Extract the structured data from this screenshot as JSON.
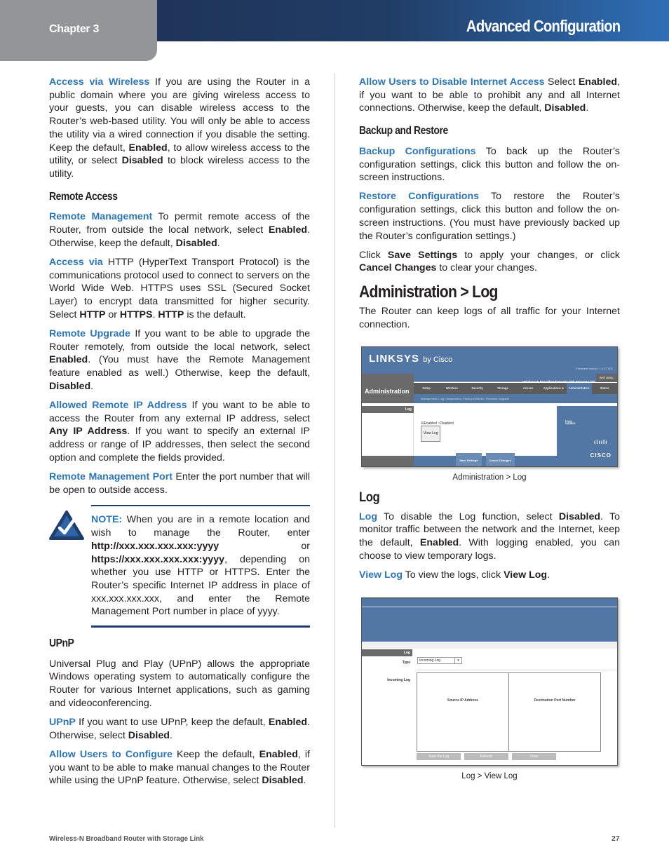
{
  "header": {
    "chapter": "Chapter 3",
    "title": "Advanced Configuration"
  },
  "left": {
    "access_wireless": {
      "term": "Access via Wireless",
      "t1": "  If you are using the Router in a public domain where you are giving wireless access to your guests, you can disable wireless access to the Router’s web-based utility. You will only be able to access the utility via a wired connection if you disable the setting. Keep the default, ",
      "b1": "Enabled",
      "t2": ", to allow wireless access to the utility, or select ",
      "b2": "Disabled",
      "t3": " to block wireless access to the utility."
    },
    "remote_access_heading": "Remote Access",
    "remote_mgmt": {
      "term": "Remote Management",
      "t1": "  To permit remote access of the Router, from outside the local network, select ",
      "b1": "Enabled",
      "t2": ". Otherwise, keep the default, ",
      "b2": "Disabled",
      "t3": "."
    },
    "access_via": {
      "term": "Access via",
      "t1": "  HTTP (HyperText Transport Protocol) is the communications protocol used to connect to servers on the World Wide Web. HTTPS uses SSL (Secured Socket Layer) to encrypt data transmitted for higher security. Select ",
      "b1": "HTTP",
      "t2": " or ",
      "b2": "HTTPS",
      "t3": ". ",
      "b3": "HTTP",
      "t4": " is the default."
    },
    "remote_upgrade": {
      "term": "Remote Upgrade",
      "t1": "  If you want to be able to upgrade the Router remotely, from outside the local network, select ",
      "b1": "Enabled",
      "t2": ". (You must have the Remote Management feature enabled as well.) Otherwise, keep the default, ",
      "b2": "Disabled",
      "t3": "."
    },
    "allowed_ip": {
      "term": "Allowed Remote IP Address",
      "t1": "  If you want to be able to access the Router from any external IP address, select ",
      "b1": "Any IP Address",
      "t2": ". If you want to specify an external IP address or range of IP addresses, then select the second option and complete the fields provided."
    },
    "remote_port": {
      "term": "Remote Management Port",
      "t1": "  Enter the port number that will be open to outside access."
    },
    "note": {
      "label": "NOTE:",
      "t1": " When you are in a remote location and wish to manage the Router, enter ",
      "b1": "http://xxx.xxx.xxx.xxx:yyyy",
      "t2": " or ",
      "b2": "https://xxx.xxx.xxx.xxx:yyyy",
      "t3": ", depending on whether you use HTTP or HTTPS. Enter the Router’s specific Internet IP address in place of xxx.xxx.xxx.xxx, and enter the Remote Management Port number in place of yyyy."
    },
    "upnp_heading": "UPnP",
    "upnp_intro": "Universal Plug and Play (UPnP) allows the appropriate Windows operating system to automatically configure the Router for various Internet applications, such as gaming and videoconferencing.",
    "upnp": {
      "term": "UPnP",
      "t1": "  If you want to use UPnP, keep the default, ",
      "b1": "Enabled",
      "t2": ". Otherwise, select ",
      "b2": "Disabled",
      "t3": "."
    },
    "allow_users": {
      "term": "Allow Users to Configure",
      "t1": "  Keep the default, ",
      "b1": "Enabled",
      "t2": ", if you want to be able to make manual changes to the Router while using the UPnP feature. Otherwise, select ",
      "b2": "Disabled",
      "t3": "."
    }
  },
  "right": {
    "allow_disable": {
      "term": "Allow Users to Disable Internet Access",
      "t1": "  Select ",
      "b1": "Enabled",
      "t2": ", if you want to be able to prohibit any and all Internet connections. Otherwise, keep the default, ",
      "b2": "Disabled",
      "t3": "."
    },
    "backup_heading": "Backup and Restore",
    "backup": {
      "term": "Backup Configurations",
      "t1": " To back up the Router’s configuration settings, click this button and follow the on-screen instructions."
    },
    "restore": {
      "term": "Restore Configurations",
      "t1": " To restore the Router’s configuration settings, click this button and follow the on-screen instructions. (You must have previously backed up the Router’s configuration settings.)"
    },
    "click": {
      "t1": "Click ",
      "b1": "Save Settings",
      "t2": " to apply your changes, or click ",
      "b2": "Cancel Changes",
      "t3": " to clear your changes."
    },
    "section_heading": "Administration > Log",
    "section_intro": "The Router can keep logs of all traffic for your Internet connection.",
    "fig1": {
      "logo": "LINKSYS",
      "logo_suffix": "by Cisco",
      "firmware": "Firmware Version: 1.0.07 B01",
      "product": "Wireless-N Broadband Router with Storage Link",
      "model": "WRT160NL",
      "section": "Administration",
      "tabs": [
        "Setup",
        "Wireless",
        "Security",
        "Storage",
        "Access Restrictions",
        "Applications & Gaming",
        "Administration",
        "Status"
      ],
      "subtabs": "Management | Log | Diagnostics | Factory Defaults | Firmware Upgrade",
      "log_label": "Log",
      "enabled": "Enabled",
      "disabled": "Disabled",
      "view_log": "View Log",
      "help": "Help...",
      "save": "Save Settings",
      "cancel": "Cancel Changes",
      "cisco": "CISCO"
    },
    "fig1_caption": "Administration > Log",
    "log_heading": "Log",
    "log": {
      "term": "Log",
      "t1": "  To disable the Log function, select ",
      "b1": "Disabled",
      "t2": ". To monitor traffic between the network and the Internet, keep the default, ",
      "b2": "Enabled",
      "t3": ". With logging enabled, you can choose to view temporary logs."
    },
    "view_log": {
      "term": "View Log",
      "t1": "  To view the logs, click ",
      "b1": "View Log",
      "t2": "."
    },
    "fig2": {
      "log_label": "Log",
      "type_label": "Type",
      "type_value": "Incoming Log",
      "incoming_label": "Incoming Log",
      "col1": "Source IP Address",
      "col2": "Destination Port Number",
      "btn1": "Save the Log",
      "btn2": "Refresh",
      "btn3": "Clear"
    },
    "fig2_caption": "Log > View Log"
  },
  "footer": {
    "product": "Wireless-N Broadband Router with Storage Link",
    "page": "27"
  }
}
